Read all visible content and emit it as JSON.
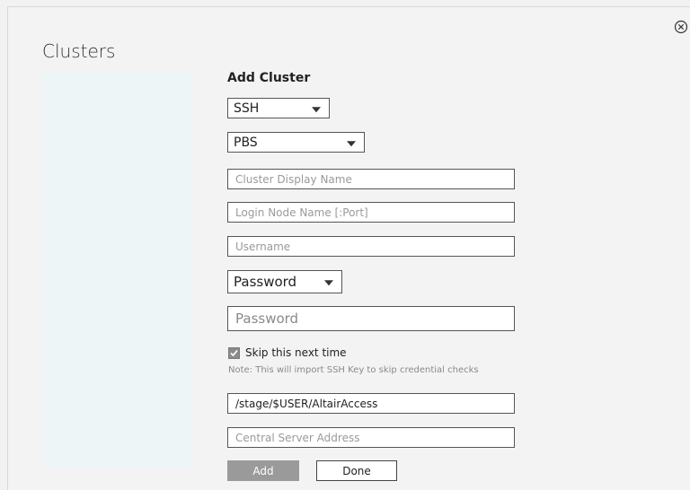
{
  "title": "Clusters",
  "form": {
    "heading": "Add Cluster",
    "connection_type": "SSH",
    "scheduler": "PBS",
    "display_name_placeholder": "Cluster Display Name",
    "login_node_placeholder": "Login Node Name [:Port]",
    "username_placeholder": "Username",
    "auth_method": "Password",
    "password_placeholder": "Password",
    "skip_label": "Skip this next time",
    "skip_checked": true,
    "note": "Note: This will import SSH Key to skip credential checks",
    "stage_path_value": "/stage/$USER/AltairAccess",
    "central_server_placeholder": "Central Server Address"
  },
  "buttons": {
    "add_label": "Add",
    "done_label": "Done"
  },
  "icons": {
    "close": "close-circle-icon",
    "dropdown": "chevron-down-icon",
    "check": "check-icon"
  },
  "colors": {
    "list_bg": "#eef5f6",
    "add_button_bg": "#9a9a9a",
    "checkbox_bg": "#8b8b8b"
  }
}
